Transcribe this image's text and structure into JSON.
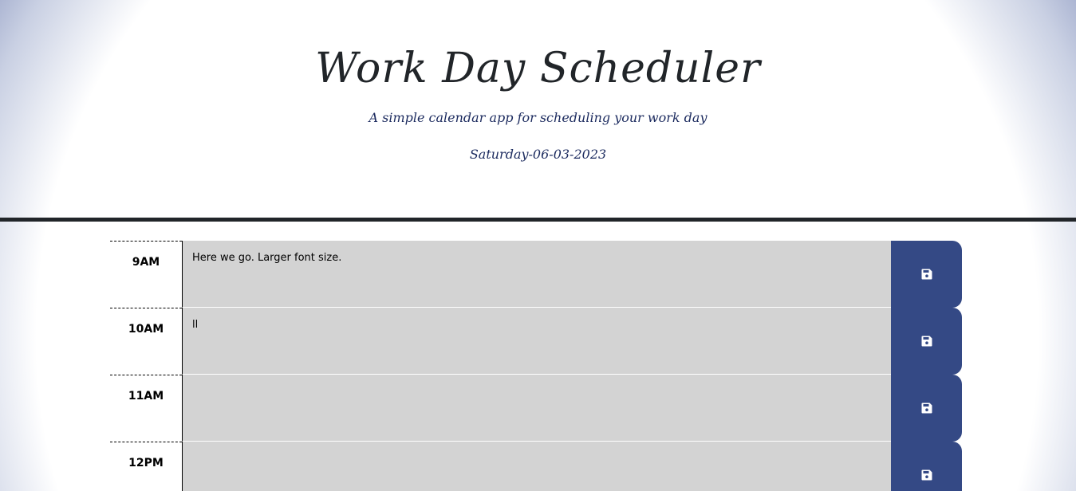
{
  "header": {
    "title": "Work Day Scheduler",
    "subtitle": "A simple calendar app for scheduling your work day",
    "current_day": "Saturday-06-03-2023"
  },
  "time_blocks": [
    {
      "hour": "9AM",
      "text": "Here we go. Larger font size.",
      "save_icon": "save-icon"
    },
    {
      "hour": "10AM",
      "text": "ll",
      "save_icon": "save-icon"
    },
    {
      "hour": "11AM",
      "text": "",
      "save_icon": "save-icon"
    },
    {
      "hour": "12PM",
      "text": "",
      "save_icon": "save-icon"
    }
  ],
  "colors": {
    "accent": "#344985",
    "block_background": "#d3d3d3",
    "divider": "#212529",
    "gradient_edge": "#0d2681"
  }
}
